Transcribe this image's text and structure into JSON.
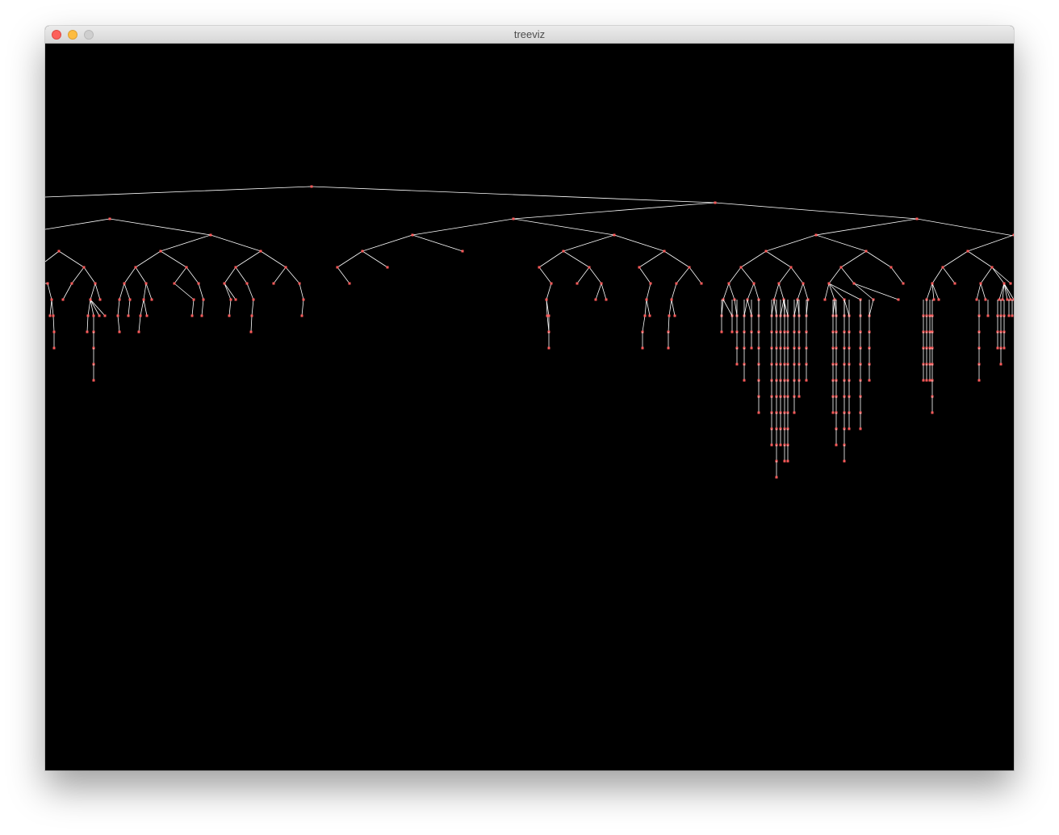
{
  "window": {
    "title": "treeviz"
  },
  "colors": {
    "background": "#000000",
    "edge": "#ffffff",
    "node": "#ff5a5a"
  },
  "tree": {
    "description_kind": "rendered tree visualization; nodes and edges drawn in the canvas"
  }
}
